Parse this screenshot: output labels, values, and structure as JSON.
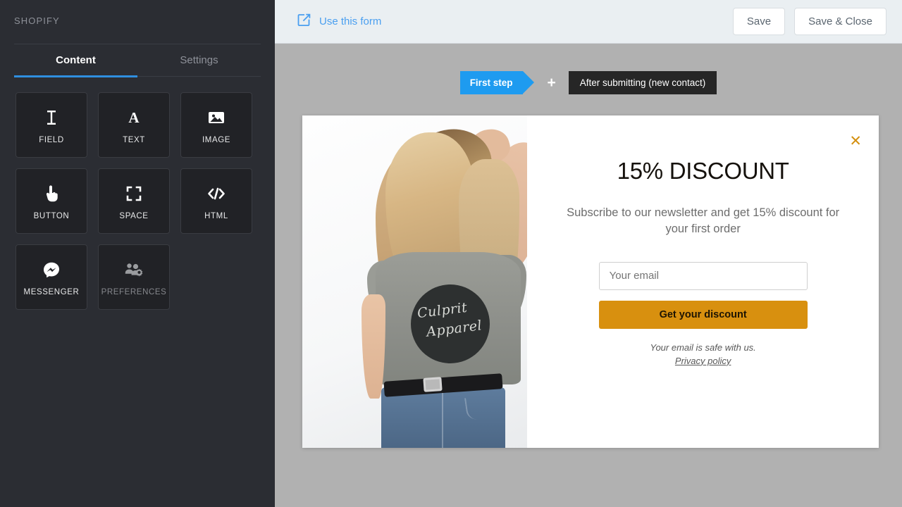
{
  "sidebar": {
    "brand": "SHOPIFY",
    "tabs": [
      {
        "label": "Content",
        "active": true
      },
      {
        "label": "Settings",
        "active": false
      }
    ],
    "tiles": [
      {
        "label": "FIELD",
        "icon": "text-cursor-icon",
        "disabled": false
      },
      {
        "label": "TEXT",
        "icon": "letter-a-icon",
        "disabled": false
      },
      {
        "label": "IMAGE",
        "icon": "image-icon",
        "disabled": false
      },
      {
        "label": "BUTTON",
        "icon": "pointer-hand-icon",
        "disabled": false
      },
      {
        "label": "SPACE",
        "icon": "expand-corners-icon",
        "disabled": false
      },
      {
        "label": "HTML",
        "icon": "code-brackets-icon",
        "disabled": false
      },
      {
        "label": "MESSENGER",
        "icon": "messenger-bubble-icon",
        "disabled": false
      },
      {
        "label": "PREFERENCES",
        "icon": "people-gear-icon",
        "disabled": true
      }
    ]
  },
  "topbar": {
    "use_form_label": "Use this form",
    "use_form_icon": "external-link-icon",
    "save_label": "Save",
    "save_close_label": "Save & Close"
  },
  "steps": {
    "first_label": "First step",
    "plus_label": "+",
    "second_label": "After submitting (new contact)"
  },
  "popup": {
    "close_icon": "close-x-icon",
    "headline": "15% DISCOUNT",
    "subline": "Subscribe to our newsletter and get 15% discount for your first order",
    "email_placeholder": "Your email",
    "email_value": "",
    "cta_label": "Get your discount",
    "safe_note": "Your email is safe with us.",
    "privacy_label": "Privacy policy",
    "photo": {
      "alt": "woman in sunglasses wearing grey t-shirt and jeans",
      "shirt_brand_line1": "Culprit",
      "shirt_brand_line2": "Apparel"
    }
  },
  "colors": {
    "sidebar_bg": "#2b2d33",
    "tile_bg": "#212226",
    "accent_blue": "#2f8fe0",
    "link_blue": "#4a9ff0",
    "step_blue": "#1e9bf0",
    "step_dark": "#262626",
    "canvas_gray": "#b1b1b1",
    "cta_orange": "#d8900f",
    "topbar_bg": "#eaeff2"
  }
}
